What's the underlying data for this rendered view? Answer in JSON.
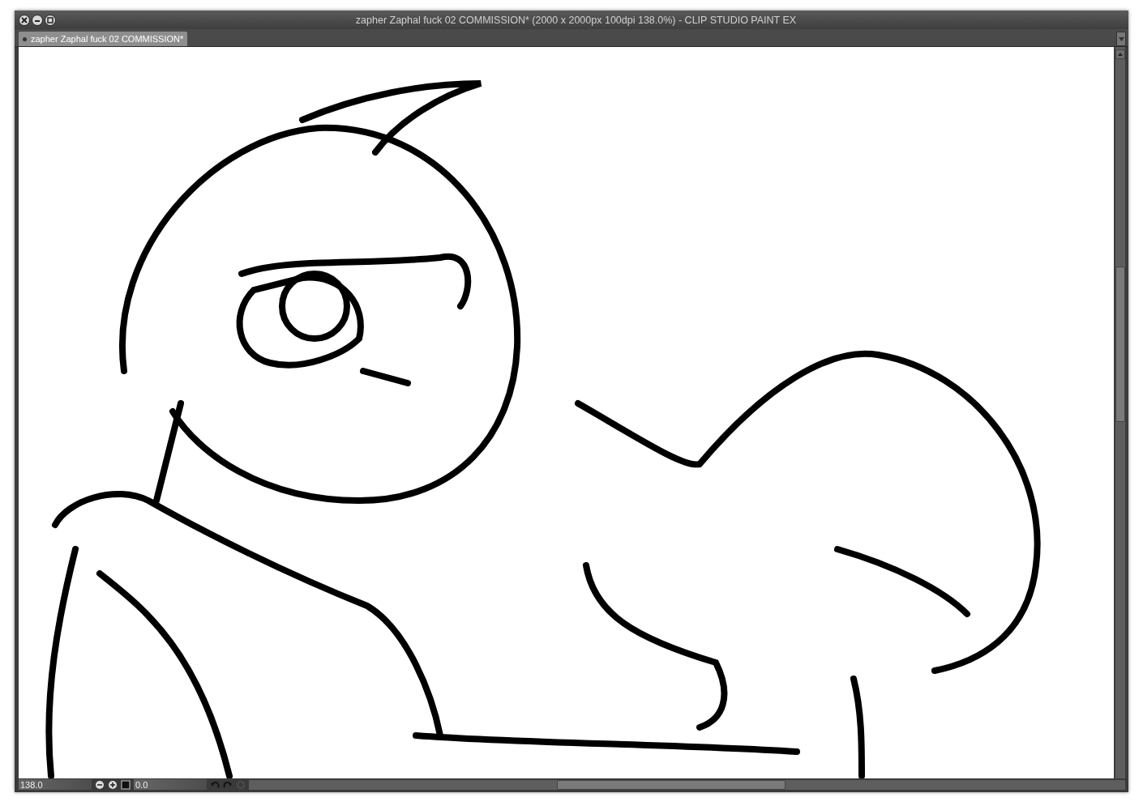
{
  "window": {
    "title": "zapher Zaphal fuck 02 COMMISSION* (2000 x 2000px 100dpi 138.0%)  - CLIP STUDIO PAINT EX"
  },
  "tabs": [
    {
      "label": "zapher Zaphal fuck 02 COMMISSION*",
      "selected": true
    }
  ],
  "navigator": {
    "zoom": "138.0",
    "rotation": "0.0"
  }
}
